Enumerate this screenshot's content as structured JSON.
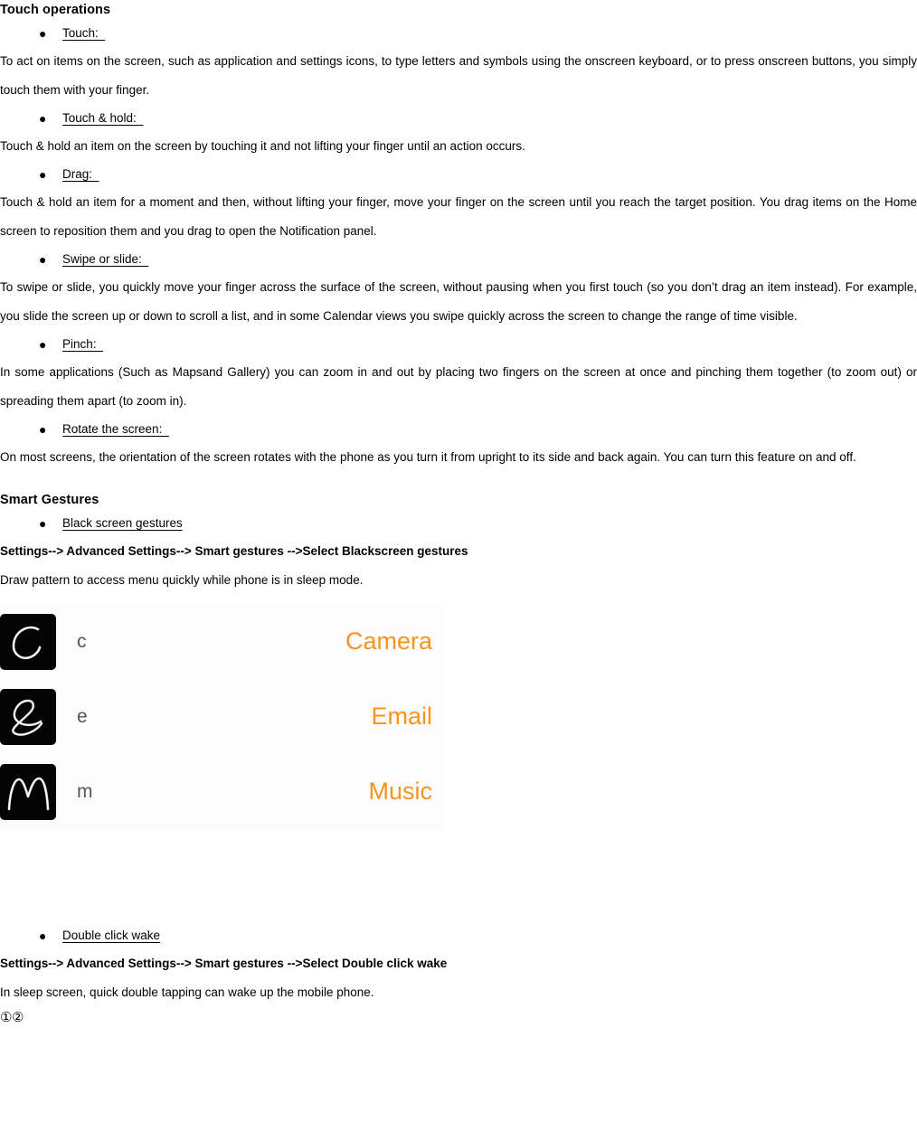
{
  "document": {
    "sections": [
      {
        "heading": "Touch operations",
        "items": [
          {
            "bullet": "●",
            "label": "Touch:  ",
            "body": "To act on items on the screen, such as application and settings icons, to type letters and symbols using the onscreen keyboard, or to press onscreen buttons, you simply touch them with your finger."
          },
          {
            "bullet": "●",
            "label": "Touch & hold:  ",
            "body": "Touch & hold an item on the screen by touching it and not lifting your finger until an action occurs."
          },
          {
            "bullet": "●",
            "label": "Drag:  ",
            "body": "Touch & hold an item for a moment and then, without lifting your finger, move your finger on the screen until you reach the target position. You drag items on the Home screen to reposition them and you drag to open the Notification panel."
          },
          {
            "bullet": "●",
            "label": "Swipe or slide:  ",
            "body": "To swipe or slide, you quickly move your finger across the surface of the screen, without pausing when you first touch (so you don’t drag an item instead). For example, you slide the screen up or down to scroll a list, and in some Calendar views you swipe quickly across the screen to change the range of time visible."
          },
          {
            "bullet": "●",
            "label": "Pinch:  ",
            "body": "In some applications (Such as Mapsand Gallery) you can zoom in and out by placing two fingers on the screen at once and pinching them together (to zoom out) or spreading them apart (to zoom in)."
          },
          {
            "bullet": "●",
            "label": "Rotate the screen:  ",
            "body": "On most screens, the orientation of the screen rotates with the phone as you turn it from upright to its side and back again. You can turn this feature on and off."
          }
        ]
      },
      {
        "heading": "Smart Gestures",
        "items": [
          {
            "bullet": "●",
            "label": "Black screen gestures",
            "path": "Settings--> Advanced Settings--> Smart gestures -->Select Blackscreen gestures",
            "body": "Draw pattern to access menu quickly while phone is in sleep mode."
          },
          {
            "bullet": "●",
            "label": "Double click wake",
            "path": "Settings--> Advanced Settings--> Smart gestures -->Select Double click wake",
            "body": "In sleep screen, quick double tapping can wake up the mobile phone."
          }
        ]
      }
    ],
    "gesture_panel": {
      "rows": [
        {
          "icon": "gesture-c-icon",
          "letter": "c",
          "app": "Camera"
        },
        {
          "icon": "gesture-e-icon",
          "letter": "e",
          "app": "Email"
        },
        {
          "icon": "gesture-m-icon",
          "letter": "m",
          "app": "Music"
        }
      ],
      "accent_color": "#f7941e",
      "thumb_background": "#040404",
      "panel_background": "#fcfcfc"
    },
    "footer_marks": "①②"
  }
}
